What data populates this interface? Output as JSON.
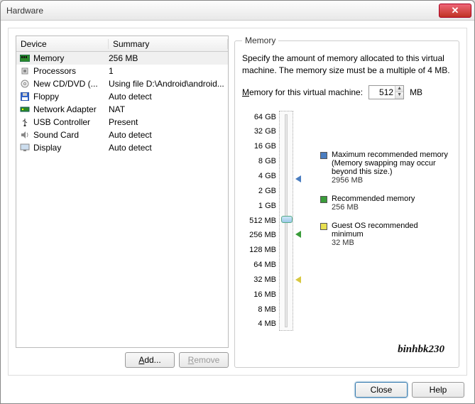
{
  "title": "Hardware",
  "table": {
    "headers": {
      "device": "Device",
      "summary": "Summary"
    },
    "rows": [
      {
        "icon": "memory",
        "device": "Memory",
        "summary": "256 MB",
        "selected": true
      },
      {
        "icon": "cpu",
        "device": "Processors",
        "summary": "1"
      },
      {
        "icon": "cd",
        "device": "New CD/DVD (...",
        "summary": "Using file D:\\Android\\android..."
      },
      {
        "icon": "floppy",
        "device": "Floppy",
        "summary": "Auto detect"
      },
      {
        "icon": "net",
        "device": "Network Adapter",
        "summary": "NAT"
      },
      {
        "icon": "usb",
        "device": "USB Controller",
        "summary": "Present"
      },
      {
        "icon": "sound",
        "device": "Sound Card",
        "summary": "Auto detect"
      },
      {
        "icon": "display",
        "device": "Display",
        "summary": "Auto detect"
      }
    ]
  },
  "buttons": {
    "add": "Add...",
    "remove": "Remove",
    "close": "Close",
    "help": "Help"
  },
  "memory": {
    "legend": "Memory",
    "desc": "Specify the amount of memory allocated to this virtual machine. The memory size must be a multiple of 4 MB.",
    "label_pre": "M",
    "label_post": "emory for this virtual machine:",
    "value": "512",
    "unit": "MB",
    "ticks": [
      "64 GB",
      "32 GB",
      "16 GB",
      "8 GB",
      "4 GB",
      "2 GB",
      "1 GB",
      "512 MB",
      "256 MB",
      "128 MB",
      "64 MB",
      "32 MB",
      "16 MB",
      "8 MB",
      "4 MB"
    ],
    "max": {
      "label": "Maximum recommended memory",
      "note": "(Memory swapping may occur beyond this size.)",
      "value": "2956 MB"
    },
    "rec": {
      "label": "Recommended memory",
      "value": "256 MB"
    },
    "min": {
      "label": "Guest OS recommended minimum",
      "value": "32 MB"
    }
  },
  "watermark": "binhbk230"
}
